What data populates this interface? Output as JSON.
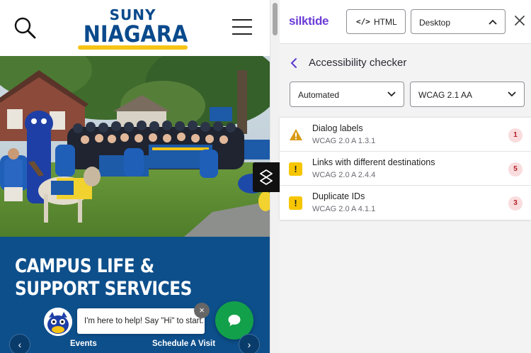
{
  "site": {
    "logo": {
      "top": "SUNY",
      "main": "NIAGARA"
    },
    "hero_heading": "CAMPUS LIFE & SUPPORT SERVICES",
    "chat": {
      "message": "I'm here to help! Say \"Hi\" to start.",
      "close_glyph": "×"
    },
    "carousel": {
      "prev_glyph": "‹",
      "next_glyph": "›"
    },
    "quick_links": [
      "Events",
      "Schedule A Visit"
    ],
    "colors": {
      "brand_blue": "#0d4f8b",
      "brand_gold": "#f6c415",
      "chat_green": "#12a04a"
    }
  },
  "panel": {
    "brand": "silktide",
    "html_button": {
      "icon": "</>",
      "label": "HTML"
    },
    "device_select": {
      "value": "Desktop"
    },
    "section_title": "Accessibility checker",
    "filters": {
      "mode": "Automated",
      "level": "WCAG 2.1 AA"
    },
    "issues": [
      {
        "icon": "warning-triangle-icon",
        "title": "Dialog labels",
        "criterion": "WCAG 2.0 A 1.3.1",
        "count": "1"
      },
      {
        "icon": "exclamation-square-icon",
        "glyph": "!",
        "title": "Links with different destinations",
        "criterion": "WCAG 2.0 A 2.4.4",
        "count": "5"
      },
      {
        "icon": "exclamation-square-icon",
        "glyph": "!",
        "title": "Duplicate IDs",
        "criterion": "WCAG 2.0 A 4.1.1",
        "count": "3"
      }
    ],
    "colors": {
      "brand_purple": "#6b3bd6",
      "warning_yellow": "#f7c600",
      "count_red": "#b31c28"
    }
  }
}
